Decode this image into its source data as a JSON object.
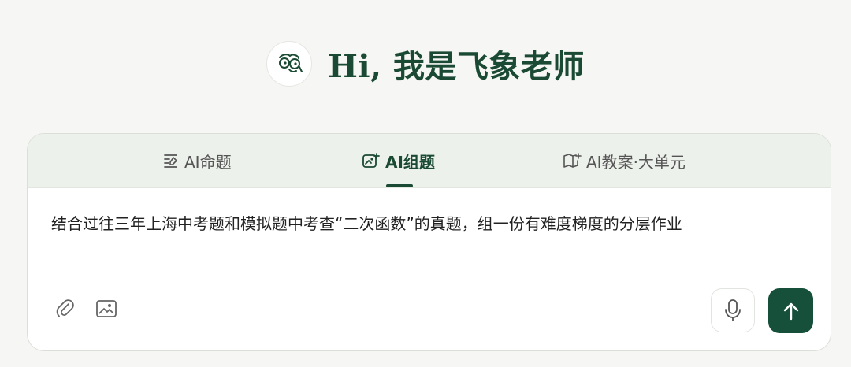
{
  "header": {
    "title": "Hi, 我是飞象老师",
    "avatar_icon": "teacher-glasses-avatar"
  },
  "tabs": [
    {
      "label": "AI命题",
      "icon": "list-edit-icon",
      "active": false
    },
    {
      "label": "AI组题",
      "icon": "image-edit-icon",
      "active": true
    },
    {
      "label": "AI教案·大单元",
      "icon": "book-icon",
      "active": false
    }
  ],
  "input": {
    "value": "结合过往三年上海中考题和模拟题中考查“二次函数”的真题，组一份有难度梯度的分层作业"
  },
  "toolbar": {
    "attach_icon": "paperclip-icon",
    "image_icon": "image-icon",
    "mic_icon": "microphone-icon",
    "send_icon": "arrow-up-icon"
  },
  "colors": {
    "brand": "#1a4a33",
    "send_button": "#16503a",
    "page_bg": "#f6f6f4",
    "tab_bar_bg": "#edf1eb"
  }
}
